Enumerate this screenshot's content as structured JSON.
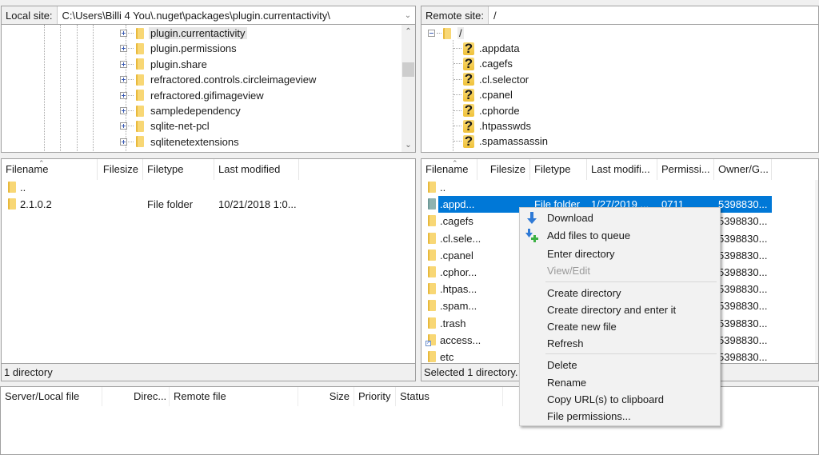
{
  "local": {
    "site_label": "Local site:",
    "path": "C:\\Users\\Billi 4 You\\.nuget\\packages\\plugin.currentactivity\\",
    "tree": [
      {
        "name": "plugin.currentactivity",
        "selected": true
      },
      {
        "name": "plugin.permissions"
      },
      {
        "name": "plugin.share"
      },
      {
        "name": "refractored.controls.circleimageview"
      },
      {
        "name": "refractored.gifimageview"
      },
      {
        "name": "sampledependency"
      },
      {
        "name": "sqlite-net-pcl"
      },
      {
        "name": "sqlitenetextensions"
      }
    ],
    "columns": [
      "Filename",
      "Filesize",
      "Filetype",
      "Last modified"
    ],
    "files": [
      {
        "name": "..",
        "size": "",
        "type": "",
        "modified": ""
      },
      {
        "name": "2.1.0.2",
        "size": "",
        "type": "File folder",
        "modified": "10/21/2018 1:0..."
      }
    ],
    "status": "1 directory"
  },
  "remote": {
    "site_label": "Remote site:",
    "path": "/",
    "tree_root": "/",
    "tree": [
      {
        "name": ".appdata"
      },
      {
        "name": ".cagefs"
      },
      {
        "name": ".cl.selector"
      },
      {
        "name": ".cpanel"
      },
      {
        "name": ".cphorde"
      },
      {
        "name": ".htpasswds"
      },
      {
        "name": ".spamassassin"
      }
    ],
    "columns": [
      "Filename",
      "Filesize",
      "Filetype",
      "Last modifi...",
      "Permissi...",
      "Owner/G..."
    ],
    "files": [
      {
        "name": "..",
        "type": "",
        "modified": "",
        "perms": "",
        "owner": "",
        "icon": "folder"
      },
      {
        "name": ".appd...",
        "type": "File folder",
        "modified": "1/27/2019 ...",
        "perms": "0711",
        "owner": "5398830...",
        "icon": "folder-dim",
        "selected": true
      },
      {
        "name": ".cagefs",
        "owner": "5398830...",
        "icon": "folder"
      },
      {
        "name": ".cl.sele...",
        "owner": "5398830...",
        "icon": "folder"
      },
      {
        "name": ".cpanel",
        "owner": "5398830...",
        "icon": "folder"
      },
      {
        "name": ".cphor...",
        "owner": "5398830...",
        "icon": "folder"
      },
      {
        "name": ".htpas...",
        "owner": "5398830...",
        "icon": "folder"
      },
      {
        "name": ".spam...",
        "owner": "5398830...",
        "icon": "folder"
      },
      {
        "name": ".trash",
        "owner": "5398830...",
        "icon": "folder"
      },
      {
        "name": "access...",
        "owner": "5398830...",
        "icon": "folder-link"
      },
      {
        "name": "etc",
        "owner": "5398830...",
        "icon": "folder"
      }
    ],
    "status": "Selected 1 directory."
  },
  "queue": {
    "columns": [
      "Server/Local file",
      "Direc...",
      "Remote file",
      "Size",
      "Priority",
      "Status"
    ]
  },
  "context_menu": {
    "items": [
      {
        "label": "Download",
        "icon": "download-arrow-icon"
      },
      {
        "label": "Add files to queue",
        "icon": "add-to-queue-icon"
      },
      {
        "label": "Enter directory"
      },
      {
        "label": "View/Edit",
        "disabled": true
      },
      {
        "label": "Create directory"
      },
      {
        "label": "Create directory and enter it"
      },
      {
        "label": "Create new file"
      },
      {
        "label": "Refresh"
      },
      {
        "label": "Delete"
      },
      {
        "label": "Rename"
      },
      {
        "label": "Copy URL(s) to clipboard"
      },
      {
        "label": "File permissions..."
      }
    ]
  },
  "colors": {
    "selection": "#0078d7",
    "download_icon": "#2f7ad6",
    "add_icon_plus": "#3cb043"
  }
}
